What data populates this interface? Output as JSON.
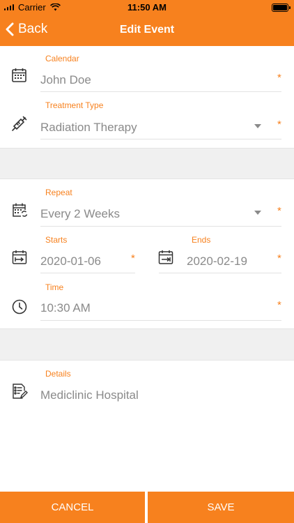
{
  "status_bar": {
    "carrier": "Carrier",
    "time": "11:50 AM"
  },
  "nav": {
    "back_label": "Back",
    "title": "Edit Event"
  },
  "form": {
    "calendar": {
      "label": "Calendar",
      "value": "John Doe",
      "required_mark": "*"
    },
    "treatment_type": {
      "label": "Treatment Type",
      "value": "Radiation Therapy",
      "required_mark": "*"
    },
    "repeat": {
      "label": "Repeat",
      "value": "Every 2 Weeks",
      "required_mark": "*"
    },
    "starts": {
      "label": "Starts",
      "value": "2020-01-06",
      "required_mark": "*"
    },
    "ends": {
      "label": "Ends",
      "value": "2020-02-19",
      "required_mark": "*"
    },
    "time": {
      "label": "Time",
      "value": "10:30 AM",
      "required_mark": "*"
    },
    "details": {
      "label": "Details",
      "value": "Mediclinic Hospital"
    }
  },
  "buttons": {
    "cancel": "CANCEL",
    "save": "SAVE"
  },
  "colors": {
    "accent": "#F7811E",
    "value_text": "#8a8a8a",
    "divider_band": "#f0f0f0"
  }
}
